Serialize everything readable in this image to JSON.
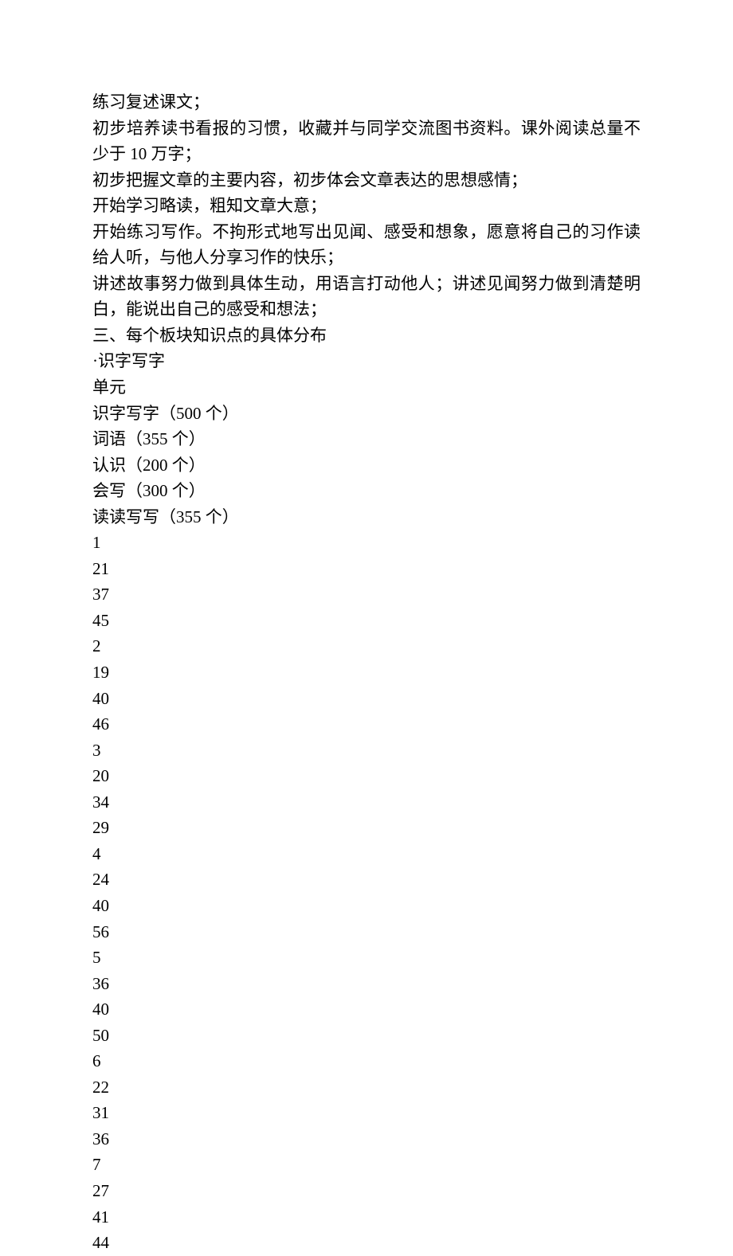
{
  "lines": [
    "练习复述课文；",
    "初步培养读书看报的习惯，收藏并与同学交流图书资料。课外阅读总量不少于 10 万字；",
    "初步把握文章的主要内容，初步体会文章表达的思想感情；",
    "开始学习略读，粗知文章大意；",
    "开始练习写作。不拘形式地写出见闻、感受和想象，愿意将自己的习作读给人听，与他人分享习作的快乐；",
    "讲述故事努力做到具体生动，用语言打动他人；讲述见闻努力做到清楚明白，能说出自己的感受和想法；",
    "三、每个板块知识点的具体分布",
    "·识字写字",
    "单元",
    "识字写字（500 个）",
    "词语（355 个）",
    "认识（200 个）",
    "会写（300 个）",
    "读读写写（355 个）",
    "1",
    "21",
    "37",
    "45",
    "2",
    "19",
    "40",
    "46",
    "3",
    "20",
    "34",
    "29",
    "4",
    "24",
    "40",
    "56",
    "5",
    "36",
    "40",
    "50",
    "6",
    "22",
    "31",
    "36",
    "7",
    "27",
    "41",
    "44"
  ]
}
